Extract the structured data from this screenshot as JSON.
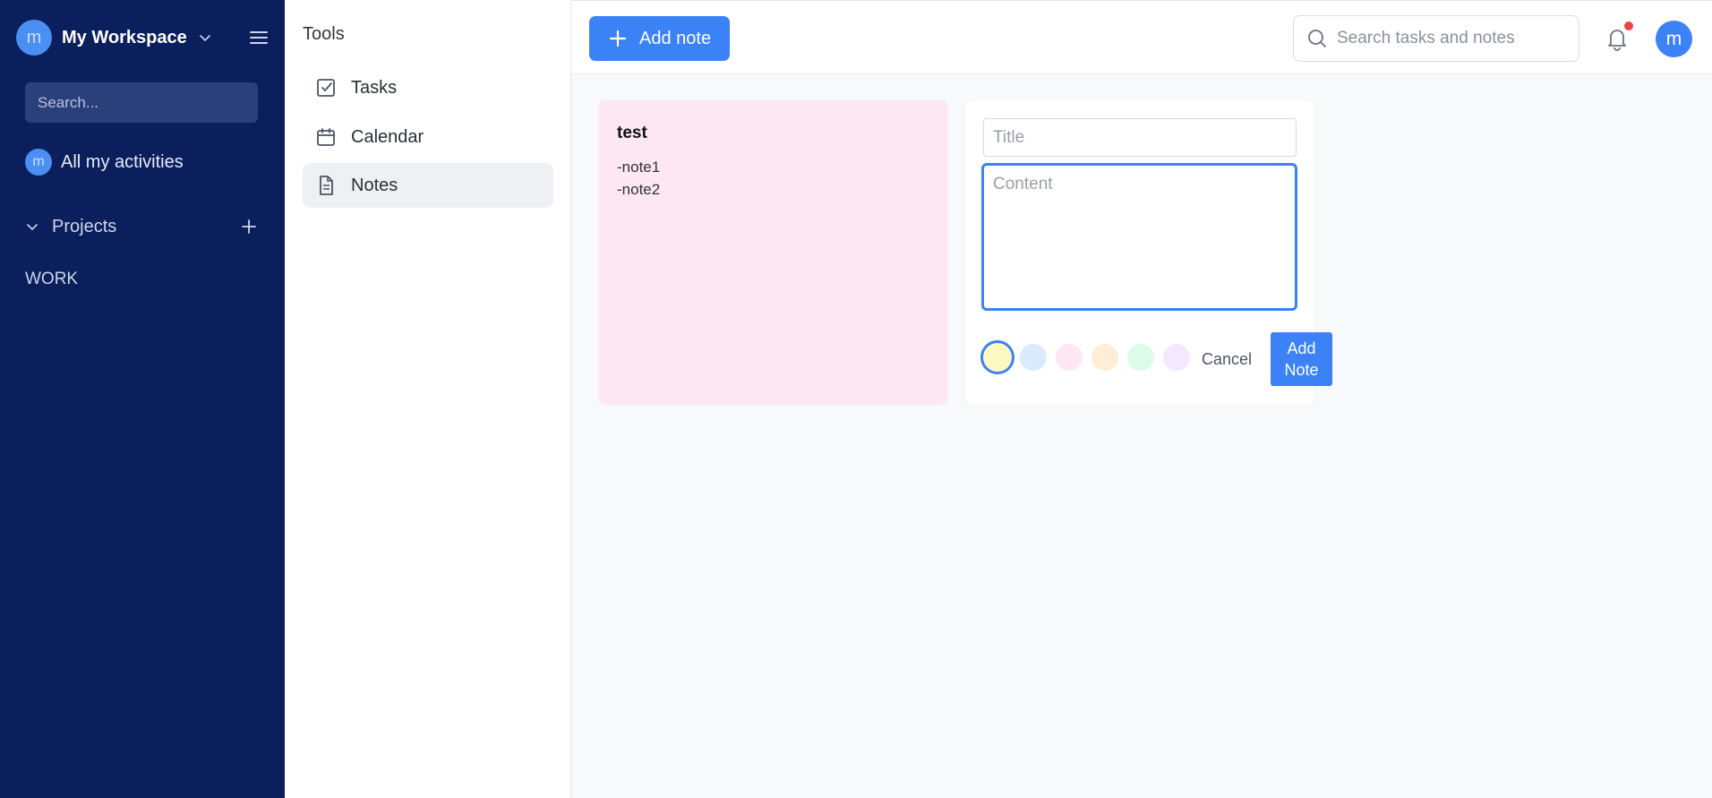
{
  "sidebar": {
    "avatar_letter": "m",
    "workspace_name": "My Workspace",
    "search_placeholder": "Search...",
    "activities_avatar": "m",
    "activities_label": "All my activities",
    "projects_label": "Projects",
    "project_items": [
      "WORK"
    ],
    "bg_color": "#0b1f5c"
  },
  "tools": {
    "title": "Tools",
    "items": [
      {
        "label": "Tasks",
        "icon": "checkbox-icon"
      },
      {
        "label": "Calendar",
        "icon": "calendar-icon"
      },
      {
        "label": "Notes",
        "icon": "document-icon",
        "active": true
      }
    ]
  },
  "header": {
    "add_button_label": "Add note",
    "search_placeholder": "Search tasks and notes",
    "user_avatar": "m",
    "accent_color": "#3b82f6",
    "notification_dot_color": "#ef4444"
  },
  "notes": [
    {
      "title": "test",
      "lines": [
        "-note1",
        "-note2"
      ],
      "color": "#fce7f3"
    }
  ],
  "form": {
    "title_placeholder": "Title",
    "content_placeholder": "Content",
    "colors": [
      "#fef9c3",
      "#dbeafe",
      "#fce7f3",
      "#ffedd5",
      "#dcfce7",
      "#f3e8ff"
    ],
    "selected_color_index": 0,
    "cancel_label": "Cancel",
    "submit_line1": "Add",
    "submit_line2": "Note"
  }
}
